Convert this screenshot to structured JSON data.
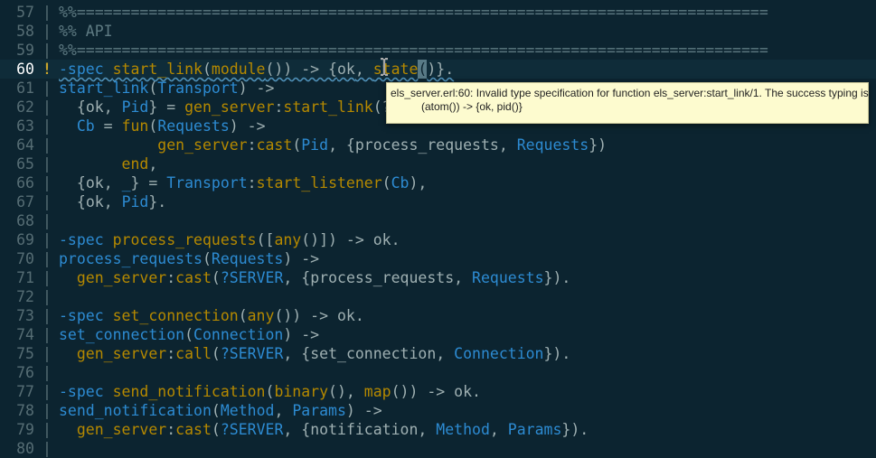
{
  "editor": {
    "lines": [
      {
        "n": "57",
        "tokens": [
          {
            "t": "%%=============================================================================",
            "c": "cm"
          }
        ]
      },
      {
        "n": "58",
        "tokens": [
          {
            "t": "%% API",
            "c": "cm"
          }
        ]
      },
      {
        "n": "59",
        "tokens": [
          {
            "t": "%%=============================================================================",
            "c": "cm"
          }
        ]
      },
      {
        "n": "60",
        "current": true,
        "marker": "!",
        "tokens": [
          {
            "t": "-spec ",
            "c": "kw"
          },
          {
            "t": "start_link",
            "c": "fn"
          },
          {
            "t": "(",
            "c": "pl"
          },
          {
            "t": "module",
            "c": "fn"
          },
          {
            "t": "()) -> {",
            "c": "pl"
          },
          {
            "t": "ok",
            "c": "at"
          },
          {
            "t": ", ",
            "c": "pl"
          },
          {
            "t": "state",
            "c": "fn"
          },
          {
            "t": "(",
            "c": "cursor"
          },
          {
            "t": ")}.",
            "c": "pl"
          }
        ]
      },
      {
        "n": "61",
        "tokens": [
          {
            "t": "start_link",
            "c": "kw"
          },
          {
            "t": "(",
            "c": "pl"
          },
          {
            "t": "Transport",
            "c": "va"
          },
          {
            "t": ") ->",
            "c": "pl"
          }
        ]
      },
      {
        "n": "62",
        "tokens": [
          {
            "t": "  {",
            "c": "pl"
          },
          {
            "t": "ok",
            "c": "at"
          },
          {
            "t": ", ",
            "c": "pl"
          },
          {
            "t": "Pid",
            "c": "va"
          },
          {
            "t": "} = ",
            "c": "pl"
          },
          {
            "t": "gen_server",
            "c": "fn"
          },
          {
            "t": ":",
            "c": "pl"
          },
          {
            "t": "start_link",
            "c": "fn"
          },
          {
            "t": "(?",
            "c": "pl"
          }
        ]
      },
      {
        "n": "63",
        "tokens": [
          {
            "t": "  ",
            "c": "pl"
          },
          {
            "t": "Cb",
            "c": "va"
          },
          {
            "t": " = ",
            "c": "pl"
          },
          {
            "t": "fun",
            "c": "fn"
          },
          {
            "t": "(",
            "c": "pl"
          },
          {
            "t": "Requests",
            "c": "va"
          },
          {
            "t": ") ->",
            "c": "pl"
          }
        ]
      },
      {
        "n": "64",
        "tokens": [
          {
            "t": "           ",
            "c": "pl"
          },
          {
            "t": "gen_server",
            "c": "fn"
          },
          {
            "t": ":",
            "c": "pl"
          },
          {
            "t": "cast",
            "c": "fn"
          },
          {
            "t": "(",
            "c": "pl"
          },
          {
            "t": "Pid",
            "c": "va"
          },
          {
            "t": ", {",
            "c": "pl"
          },
          {
            "t": "process_requests",
            "c": "at"
          },
          {
            "t": ", ",
            "c": "pl"
          },
          {
            "t": "Requests",
            "c": "va"
          },
          {
            "t": "})",
            "c": "pl"
          }
        ]
      },
      {
        "n": "65",
        "tokens": [
          {
            "t": "       ",
            "c": "pl"
          },
          {
            "t": "end",
            "c": "fn"
          },
          {
            "t": ",",
            "c": "pl"
          }
        ]
      },
      {
        "n": "66",
        "tokens": [
          {
            "t": "  {",
            "c": "pl"
          },
          {
            "t": "ok",
            "c": "at"
          },
          {
            "t": ", ",
            "c": "pl"
          },
          {
            "t": "_",
            "c": "va"
          },
          {
            "t": "} = ",
            "c": "pl"
          },
          {
            "t": "Transport",
            "c": "va"
          },
          {
            "t": ":",
            "c": "pl"
          },
          {
            "t": "start_listener",
            "c": "fn"
          },
          {
            "t": "(",
            "c": "pl"
          },
          {
            "t": "Cb",
            "c": "va"
          },
          {
            "t": "),",
            "c": "pl"
          }
        ]
      },
      {
        "n": "67",
        "tokens": [
          {
            "t": "  {",
            "c": "pl"
          },
          {
            "t": "ok",
            "c": "at"
          },
          {
            "t": ", ",
            "c": "pl"
          },
          {
            "t": "Pid",
            "c": "va"
          },
          {
            "t": "}.",
            "c": "pl"
          }
        ]
      },
      {
        "n": "68",
        "tokens": []
      },
      {
        "n": "69",
        "tokens": [
          {
            "t": "-spec ",
            "c": "kw"
          },
          {
            "t": "process_requests",
            "c": "fn"
          },
          {
            "t": "([",
            "c": "pl"
          },
          {
            "t": "any",
            "c": "fn"
          },
          {
            "t": "()]) -> ",
            "c": "pl"
          },
          {
            "t": "ok",
            "c": "at"
          },
          {
            "t": ".",
            "c": "pl"
          }
        ]
      },
      {
        "n": "70",
        "tokens": [
          {
            "t": "process_requests",
            "c": "kw"
          },
          {
            "t": "(",
            "c": "pl"
          },
          {
            "t": "Requests",
            "c": "va"
          },
          {
            "t": ") ->",
            "c": "pl"
          }
        ]
      },
      {
        "n": "71",
        "tokens": [
          {
            "t": "  ",
            "c": "pl"
          },
          {
            "t": "gen_server",
            "c": "fn"
          },
          {
            "t": ":",
            "c": "pl"
          },
          {
            "t": "cast",
            "c": "fn"
          },
          {
            "t": "(",
            "c": "pl"
          },
          {
            "t": "?SERVER",
            "c": "ma"
          },
          {
            "t": ", {",
            "c": "pl"
          },
          {
            "t": "process_requests",
            "c": "at"
          },
          {
            "t": ", ",
            "c": "pl"
          },
          {
            "t": "Requests",
            "c": "va"
          },
          {
            "t": "}).",
            "c": "pl"
          }
        ]
      },
      {
        "n": "72",
        "tokens": []
      },
      {
        "n": "73",
        "tokens": [
          {
            "t": "-spec ",
            "c": "kw"
          },
          {
            "t": "set_connection",
            "c": "fn"
          },
          {
            "t": "(",
            "c": "pl"
          },
          {
            "t": "any",
            "c": "fn"
          },
          {
            "t": "()) -> ",
            "c": "pl"
          },
          {
            "t": "ok",
            "c": "at"
          },
          {
            "t": ".",
            "c": "pl"
          }
        ]
      },
      {
        "n": "74",
        "tokens": [
          {
            "t": "set_connection",
            "c": "kw"
          },
          {
            "t": "(",
            "c": "pl"
          },
          {
            "t": "Connection",
            "c": "va"
          },
          {
            "t": ") ->",
            "c": "pl"
          }
        ]
      },
      {
        "n": "75",
        "tokens": [
          {
            "t": "  ",
            "c": "pl"
          },
          {
            "t": "gen_server",
            "c": "fn"
          },
          {
            "t": ":",
            "c": "pl"
          },
          {
            "t": "call",
            "c": "fn"
          },
          {
            "t": "(",
            "c": "pl"
          },
          {
            "t": "?SERVER",
            "c": "ma"
          },
          {
            "t": ", {",
            "c": "pl"
          },
          {
            "t": "set_connection",
            "c": "at"
          },
          {
            "t": ", ",
            "c": "pl"
          },
          {
            "t": "Connection",
            "c": "va"
          },
          {
            "t": "}).",
            "c": "pl"
          }
        ]
      },
      {
        "n": "76",
        "tokens": []
      },
      {
        "n": "77",
        "tokens": [
          {
            "t": "-spec ",
            "c": "kw"
          },
          {
            "t": "send_notification",
            "c": "fn"
          },
          {
            "t": "(",
            "c": "pl"
          },
          {
            "t": "binary",
            "c": "fn"
          },
          {
            "t": "(), ",
            "c": "pl"
          },
          {
            "t": "map",
            "c": "fn"
          },
          {
            "t": "()) -> ",
            "c": "pl"
          },
          {
            "t": "ok",
            "c": "at"
          },
          {
            "t": ".",
            "c": "pl"
          }
        ]
      },
      {
        "n": "78",
        "tokens": [
          {
            "t": "send_notification",
            "c": "kw"
          },
          {
            "t": "(",
            "c": "pl"
          },
          {
            "t": "Method",
            "c": "va"
          },
          {
            "t": ", ",
            "c": "pl"
          },
          {
            "t": "Params",
            "c": "va"
          },
          {
            "t": ") ->",
            "c": "pl"
          }
        ]
      },
      {
        "n": "79",
        "tokens": [
          {
            "t": "  ",
            "c": "pl"
          },
          {
            "t": "gen_server",
            "c": "fn"
          },
          {
            "t": ":",
            "c": "pl"
          },
          {
            "t": "cast",
            "c": "fn"
          },
          {
            "t": "(",
            "c": "pl"
          },
          {
            "t": "?SERVER",
            "c": "ma"
          },
          {
            "t": ", {",
            "c": "pl"
          },
          {
            "t": "notification",
            "c": "at"
          },
          {
            "t": ", ",
            "c": "pl"
          },
          {
            "t": "Method",
            "c": "va"
          },
          {
            "t": ", ",
            "c": "pl"
          },
          {
            "t": "Params",
            "c": "va"
          },
          {
            "t": "}).",
            "c": "pl"
          }
        ]
      },
      {
        "n": "80",
        "tokens": []
      }
    ]
  },
  "tooltip": {
    "line1": "els_server.erl:60: Invalid type specification for function els_server:start_link/1. The success typing is",
    "line2": "(atom()) -> {ok, pid()}"
  },
  "theme": {
    "background": "#0c2430",
    "keyword": "#2d8bd2",
    "function": "#b58900",
    "comment": "#5e7a82",
    "warning_marker": "#c7a32b",
    "tooltip_bg": "#fdfbcf"
  },
  "icons": {
    "mouse_cursor": "ibeam-cursor-icon"
  }
}
